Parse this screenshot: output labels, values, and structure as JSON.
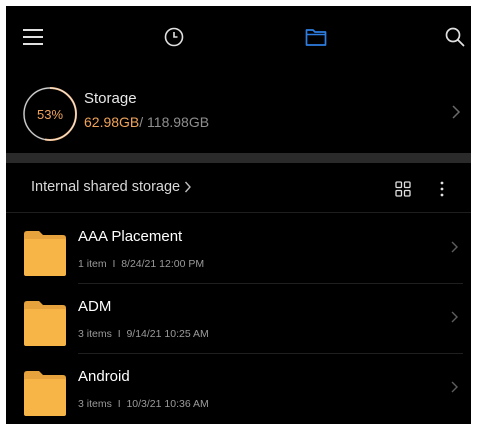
{
  "topbar": {
    "icons": [
      "menu-icon",
      "clock-icon",
      "folder-icon",
      "search-icon"
    ],
    "accent": "#2f7de1"
  },
  "storage": {
    "percent_label": "53%",
    "percent_value": 53,
    "title": "Storage",
    "used": "62.98GB",
    "total": "/ 118.98GB",
    "ring_color": "#f0a35a"
  },
  "section": {
    "title": "Internal shared storage"
  },
  "files": [
    {
      "name": "AAA Placement",
      "count": "1 item",
      "sep": "I",
      "date": "8/24/21 12:00 PM"
    },
    {
      "name": "ADM",
      "count": "3 items",
      "sep": "I",
      "date": "9/14/21 10:25 AM"
    },
    {
      "name": "Android",
      "count": "3 items",
      "sep": "I",
      "date": "10/3/21 10:36 AM"
    }
  ],
  "colors": {
    "folder": "#f7b548",
    "folder_tab": "#e6a23c"
  }
}
